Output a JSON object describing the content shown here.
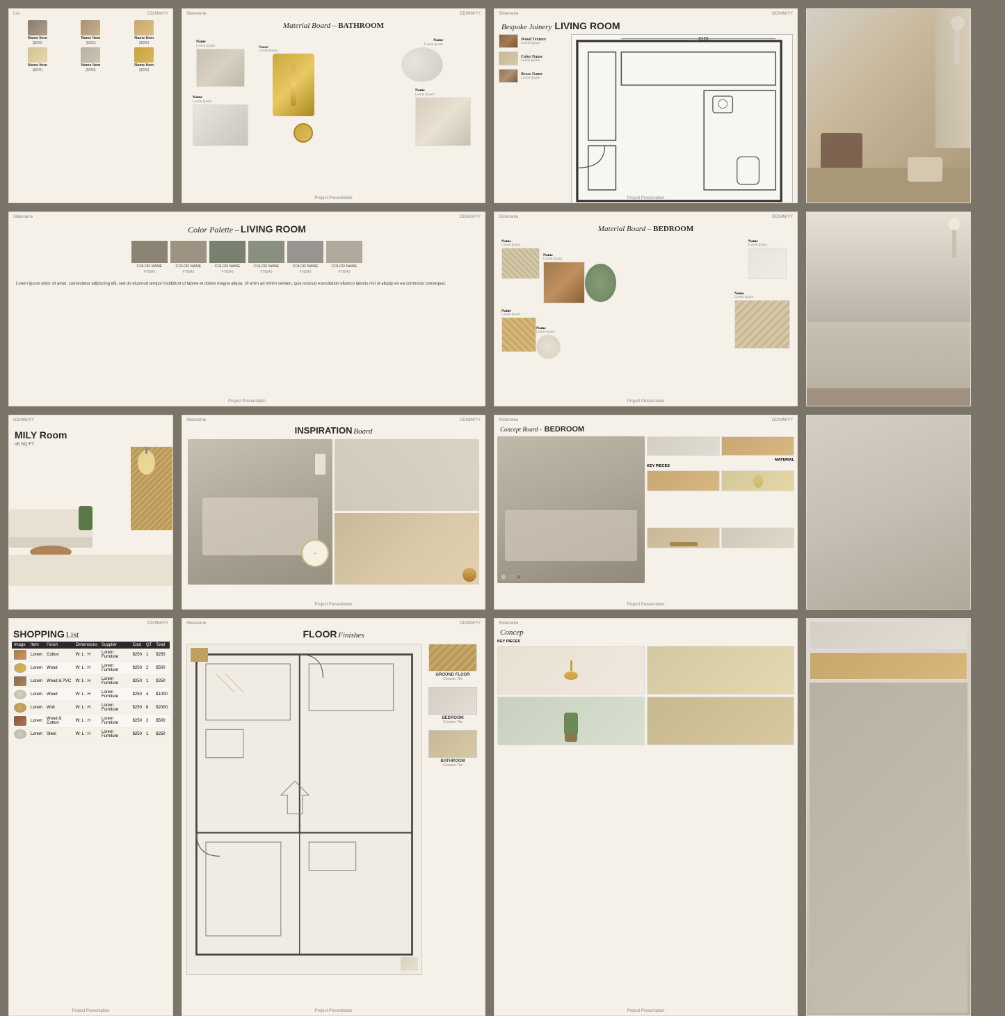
{
  "background_color": "#7a7568",
  "slides": {
    "shopping_top": {
      "title": "List",
      "date": "DD/MM/YY",
      "items": [
        {
          "name": "Name Item",
          "price": "($200)"
        },
        {
          "name": "Name Item",
          "price": "($200)"
        },
        {
          "name": "Name Item",
          "price": "($200)"
        },
        {
          "name": "Name Item",
          "price": "($200)"
        },
        {
          "name": "Name Item",
          "price": "($200)"
        },
        {
          "name": "Name Item",
          "price": "($200)"
        }
      ]
    },
    "bathroom": {
      "slidename": "Slidename",
      "date": "DD/MM/YY",
      "title_italic": "Material Board –",
      "title_bold": "BATHROOM",
      "footer": "Project Presentation",
      "items": [
        {
          "name": "Name",
          "sub": "Lorem Ipsum"
        },
        {
          "name": "Name",
          "sub": "Lorem Ipsum"
        },
        {
          "name": "Name",
          "sub": "Lorem Ipsum"
        },
        {
          "name": "Name",
          "sub": "Lorem Ipsum"
        },
        {
          "name": "Name",
          "sub": "Lorem Ipsum"
        }
      ]
    },
    "joinery": {
      "slidename": "Slidename",
      "date": "DD/MM/YY",
      "title_italic": "Bespoke Joinery",
      "title_bold": "LIVING ROOM",
      "footer": "Project Presentation",
      "swatches": [
        {
          "name": "Wood Texture",
          "sub": "Lorem Ipsum"
        },
        {
          "name": "Color Name",
          "sub": "Lorem Ipsum"
        },
        {
          "name": "Brass Name",
          "sub": "Lorem Ipsum"
        }
      ]
    },
    "color_palette": {
      "slidename": "Slidename",
      "date": "DD/MM/YY",
      "title_italic": "Color Palette –",
      "title_bold": "LIVING ROOM",
      "footer": "Project Presentation",
      "swatches": [
        {
          "name": "COLOR NAME",
          "code": "F76542",
          "color": "#8b8475"
        },
        {
          "name": "COLOR NAME",
          "code": "F76542",
          "color": "#9e9282"
        },
        {
          "name": "COLOR NAME",
          "code": "F76540",
          "color": "#7a8070"
        },
        {
          "name": "COLOR NAME",
          "code": "F76540",
          "color": "#8a9080"
        },
        {
          "name": "COLOR NAME",
          "code": "F76542",
          "color": "#9a9490"
        },
        {
          "name": "COLOR NAME",
          "code": "F76542",
          "color": "#b0aa9e"
        }
      ],
      "body_text": "Lorem ipsum dolor sit amet, consectetur adipiscing elit, sed do eiusmod tempor incididunt ut labore et dolore magna aliqua. Ut enim ad minim veniam, quis nostrud exercitation ullamco laboris nisi ut aliquip ex ea commodo consequat."
    },
    "bedroom_material": {
      "slidename": "Slidename",
      "date": "DD/MM/YY",
      "title_italic": "Material Board –",
      "title_bold": "BEDROOM",
      "footer": "Project Presentation",
      "items": [
        {
          "name": "Name",
          "sub": "Lorem Ipsum"
        },
        {
          "name": "Name",
          "sub": "Lorem Ipsum"
        },
        {
          "name": "Name",
          "sub": "Lorem Ipsum"
        },
        {
          "name": "Name",
          "sub": "Lorem Ipsum"
        },
        {
          "name": "Name",
          "sub": "Lorem Ipsum"
        },
        {
          "name": "Name",
          "sub": "Lorem Ipsum"
        }
      ]
    },
    "family": {
      "date": "DD/MM/YY",
      "title1": "MILY Room",
      "title2": "oft",
      "sqft": "SQ FT"
    },
    "inspiration": {
      "slidename": "Slidename",
      "date": "DD/MM/YY",
      "title_bold": "INSPIRATION",
      "title_italic": "Board",
      "footer": "Project Presentation"
    },
    "concept_bedroom": {
      "slidename": "Slidename",
      "date": "DD/MM/YY",
      "title": "Concept Board -",
      "title_bold": "BEDROOM",
      "footer": "Project Presentation",
      "labels": [
        "MATERIAL",
        "KEY PIECES"
      ],
      "colors": [
        "#c8bba8",
        "#a89888",
        "#8a7a6a"
      ]
    },
    "shopping_full": {
      "title_bold": "SHOPPING",
      "title_normal": "List",
      "date": "DD/MM/YY",
      "footer": "Project Presentation",
      "headers": [
        "Image",
        "Item",
        "Finish",
        "Dimensions",
        "Supplier",
        "Cost",
        "QT",
        "Total"
      ],
      "rows": [
        {
          "item": "Lorem",
          "finish": "Cotton",
          "dims": "W: L : H",
          "supplier": "Lorem Furniture",
          "cost": "$250",
          "qt": "1",
          "total": "$250"
        },
        {
          "item": "Lorem",
          "finish": "Wood",
          "dims": "W: L : H",
          "supplier": "Lorem Furniture",
          "cost": "$250",
          "qt": "2",
          "total": "$500"
        },
        {
          "item": "Lorem",
          "finish": "Wood & PVC",
          "dims": "W: L : H",
          "supplier": "Lorem Furniture",
          "cost": "$250",
          "qt": "1",
          "total": "$250"
        },
        {
          "item": "Lorem",
          "finish": "Wood",
          "dims": "W: L : H",
          "supplier": "Lorem Furniture",
          "cost": "$250",
          "qt": "4",
          "total": "$1000"
        },
        {
          "item": "Lorem",
          "finish": "Woll",
          "dims": "W: L : H",
          "supplier": "Lorem Furniture",
          "cost": "$250",
          "qt": "8",
          "total": "$2000"
        },
        {
          "item": "Lorem",
          "finish": "Wood & Cotton",
          "dims": "W: L : H",
          "supplier": "Lorem Furniture",
          "cost": "$250",
          "qt": "2",
          "total": "$500"
        },
        {
          "item": "Lorem",
          "finish": "Steel",
          "dims": "W: L : H",
          "supplier": "Lorem Furniture",
          "cost": "$250",
          "qt": "1",
          "total": "$250"
        }
      ]
    },
    "floor_finishes": {
      "slidename": "Slidename",
      "date": "DD/MM/YY",
      "title_bold": "FLOOR",
      "title_normal": "Finishes",
      "footer": "Project Presentation",
      "finishes": [
        {
          "label": "GROUND FLOOR",
          "sub": "Ceramic Tile"
        },
        {
          "label": "BEDROOM",
          "sub": "Ceramic Tile"
        },
        {
          "label": "BATHROOM",
          "sub": "Ceramic Tile"
        }
      ]
    },
    "concept_right": {
      "slidename": "Slidename",
      "title_partial": "Concep",
      "label": "KEY PIECES",
      "footer": "Project Presentation"
    }
  }
}
